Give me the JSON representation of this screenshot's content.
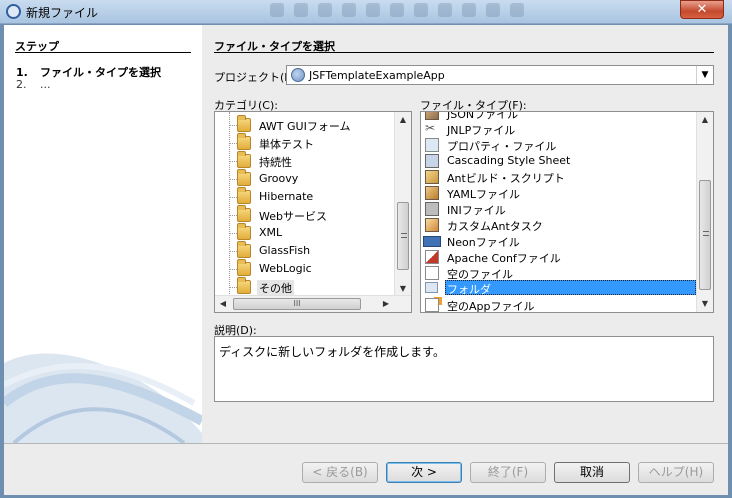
{
  "window": {
    "title": "新規ファイル",
    "close": "✕"
  },
  "steps": {
    "header": "ステップ",
    "items": [
      {
        "num": "1.",
        "label": "ファイル・タイプを選択"
      },
      {
        "num": "2.",
        "label": "..."
      }
    ]
  },
  "main": {
    "heading": "ファイル・タイプを選択",
    "project_label": "プロジェクト(P):",
    "project_value": "JSFTemplateExampleApp",
    "category_label": "カテゴリ(C):",
    "file_types_label": "ファイル・タイプ(F):",
    "categories": [
      "AWT GUIフォーム",
      "単体テスト",
      "持続性",
      "Groovy",
      "Hibernate",
      "Webサービス",
      "XML",
      "GlassFish",
      "WebLogic",
      "その他"
    ],
    "selected_category": "その他",
    "file_types": [
      "JSONファイル",
      "JNLPファイル",
      "プロパティ・ファイル",
      "Cascading Style Sheet",
      "Antビルド・スクリプト",
      "YAMLファイル",
      "INIファイル",
      "カスタムAntタスク",
      "Neonファイル",
      "Apache Confファイル",
      "空のファイル",
      "フォルダ",
      "空のAppファイル"
    ],
    "selected_file_type": "フォルダ",
    "description_label": "説明(D):",
    "description": "ディスクに新しいフォルダを作成します。",
    "scroll_grip": "III"
  },
  "buttons": {
    "back": "< 戻る(B)",
    "next": "次 >",
    "finish": "終了(F)",
    "cancel": "取消",
    "help": "ヘルプ(H)"
  },
  "colors": {
    "selection": "#3399ff",
    "titlebar": "#b9d1ea"
  }
}
